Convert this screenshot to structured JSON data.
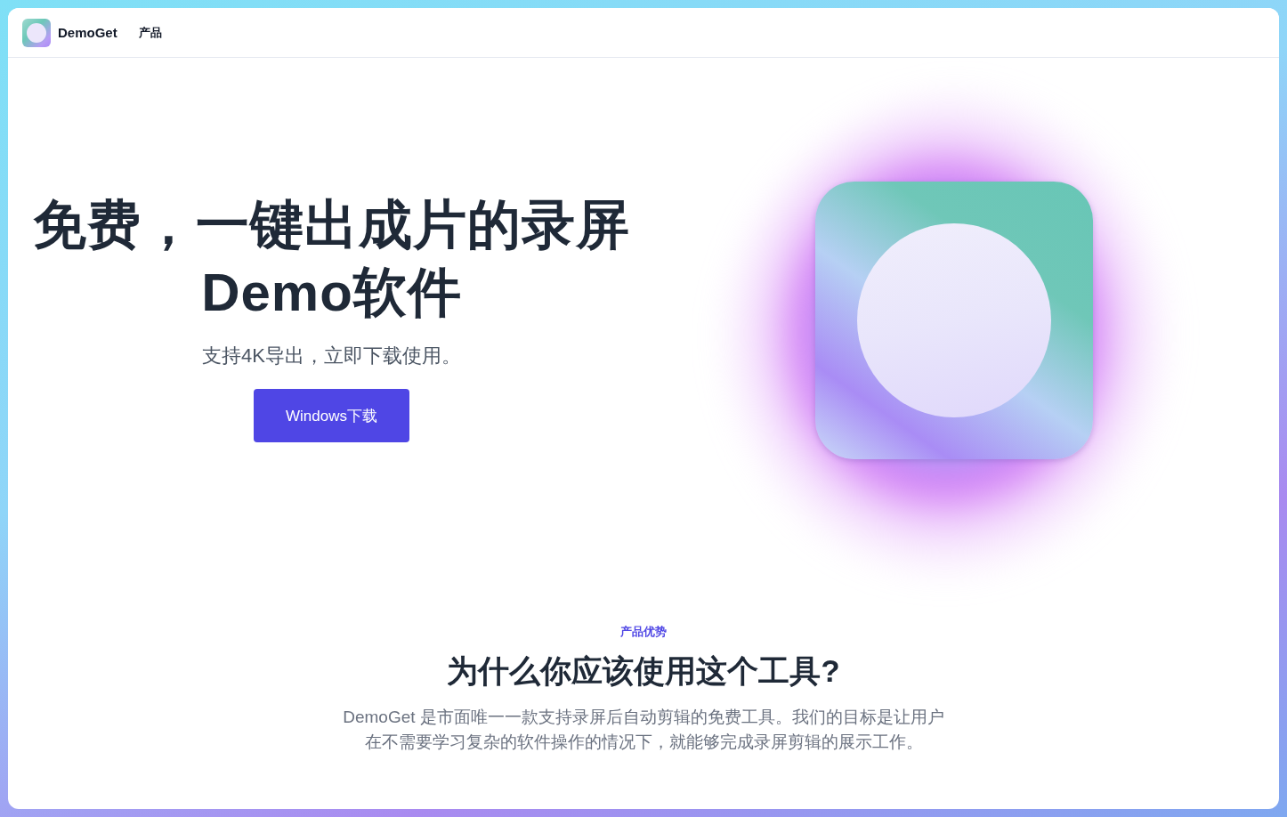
{
  "header": {
    "brand": "DemoGet",
    "nav": [
      {
        "label": "产品"
      }
    ]
  },
  "hero": {
    "title_lines": [
      "免费，一键出成片的录屏",
      "Demo软件"
    ],
    "subtitle": "支持4K导出，立即下载使用。",
    "button": "Windows下载"
  },
  "features": {
    "eyebrow": "产品优势",
    "title": "为什么你应该使用这个工具?",
    "description": "DemoGet 是市面唯一一款支持录屏后自动剪辑的免费工具。我们的目标是让用户在不需要学习复杂的软件操作的情况下，就能够完成录屏剪辑的展示工作。"
  }
}
